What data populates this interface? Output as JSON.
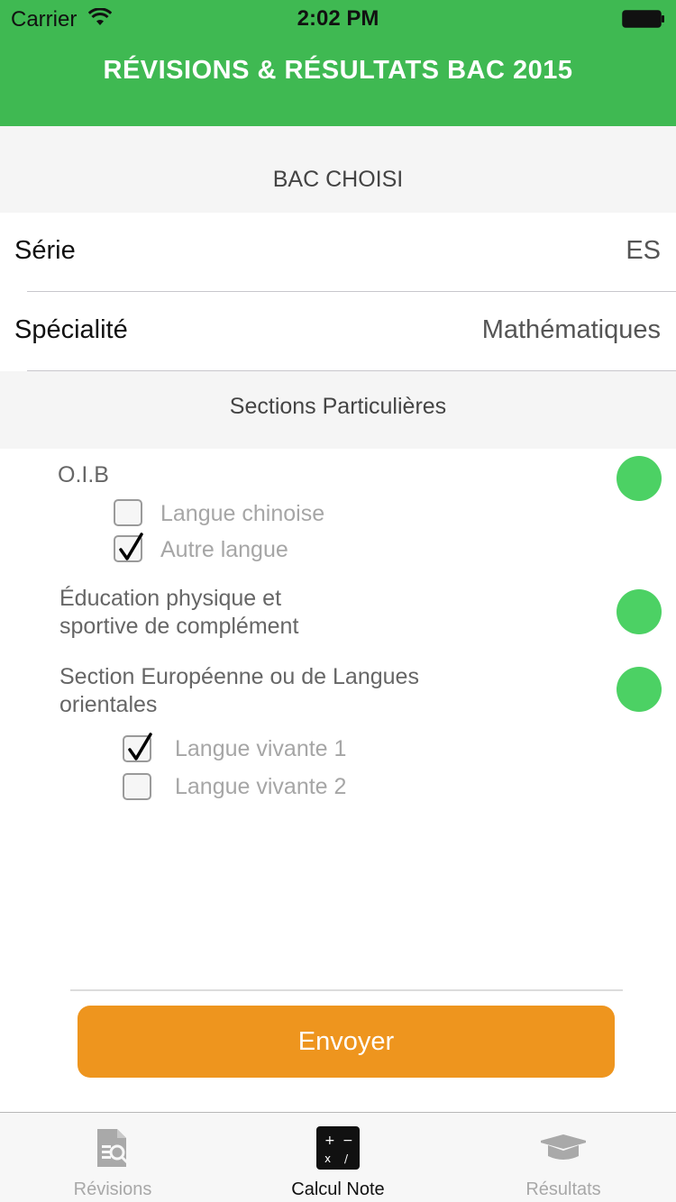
{
  "status_bar": {
    "carrier": "Carrier",
    "time": "2:02 PM"
  },
  "nav": {
    "title": "RÉVISIONS & RÉSULTATS BAC 2015"
  },
  "bac_section": {
    "header": "BAC CHOISI",
    "rows": [
      {
        "label": "Série",
        "value": "ES"
      },
      {
        "label": "Spécialité",
        "value": "Mathématiques"
      }
    ]
  },
  "sections_particulieres": {
    "header": "Sections Particulières",
    "oib": {
      "title": "O.I.B",
      "enabled": true,
      "options": [
        {
          "label": "Langue chinoise",
          "checked": false
        },
        {
          "label": "Autre langue",
          "checked": true
        }
      ]
    },
    "eps": {
      "title_line1": "Éducation physique et",
      "title_line2": "sportive de complément",
      "enabled": true
    },
    "europeenne": {
      "title_line1": "Section Européenne ou de Langues",
      "title_line2": "orientales",
      "enabled": true,
      "options": [
        {
          "label": "Langue vivante 1",
          "checked": true
        },
        {
          "label": "Langue vivante 2",
          "checked": false
        }
      ]
    }
  },
  "send_button": {
    "label": "Envoyer"
  },
  "tab_bar": {
    "tabs": [
      {
        "label": "Révisions",
        "icon": "revisions-icon",
        "active": false
      },
      {
        "label": "Calcul Note",
        "icon": "calculator-icon",
        "active": true
      },
      {
        "label": "Résultats",
        "icon": "graduation-cap-icon",
        "active": false
      }
    ]
  },
  "colors": {
    "header_green": "#3fb952",
    "toggle_green": "#4cd164",
    "button_orange": "#ee951e",
    "section_bg": "#f5f5f5"
  }
}
